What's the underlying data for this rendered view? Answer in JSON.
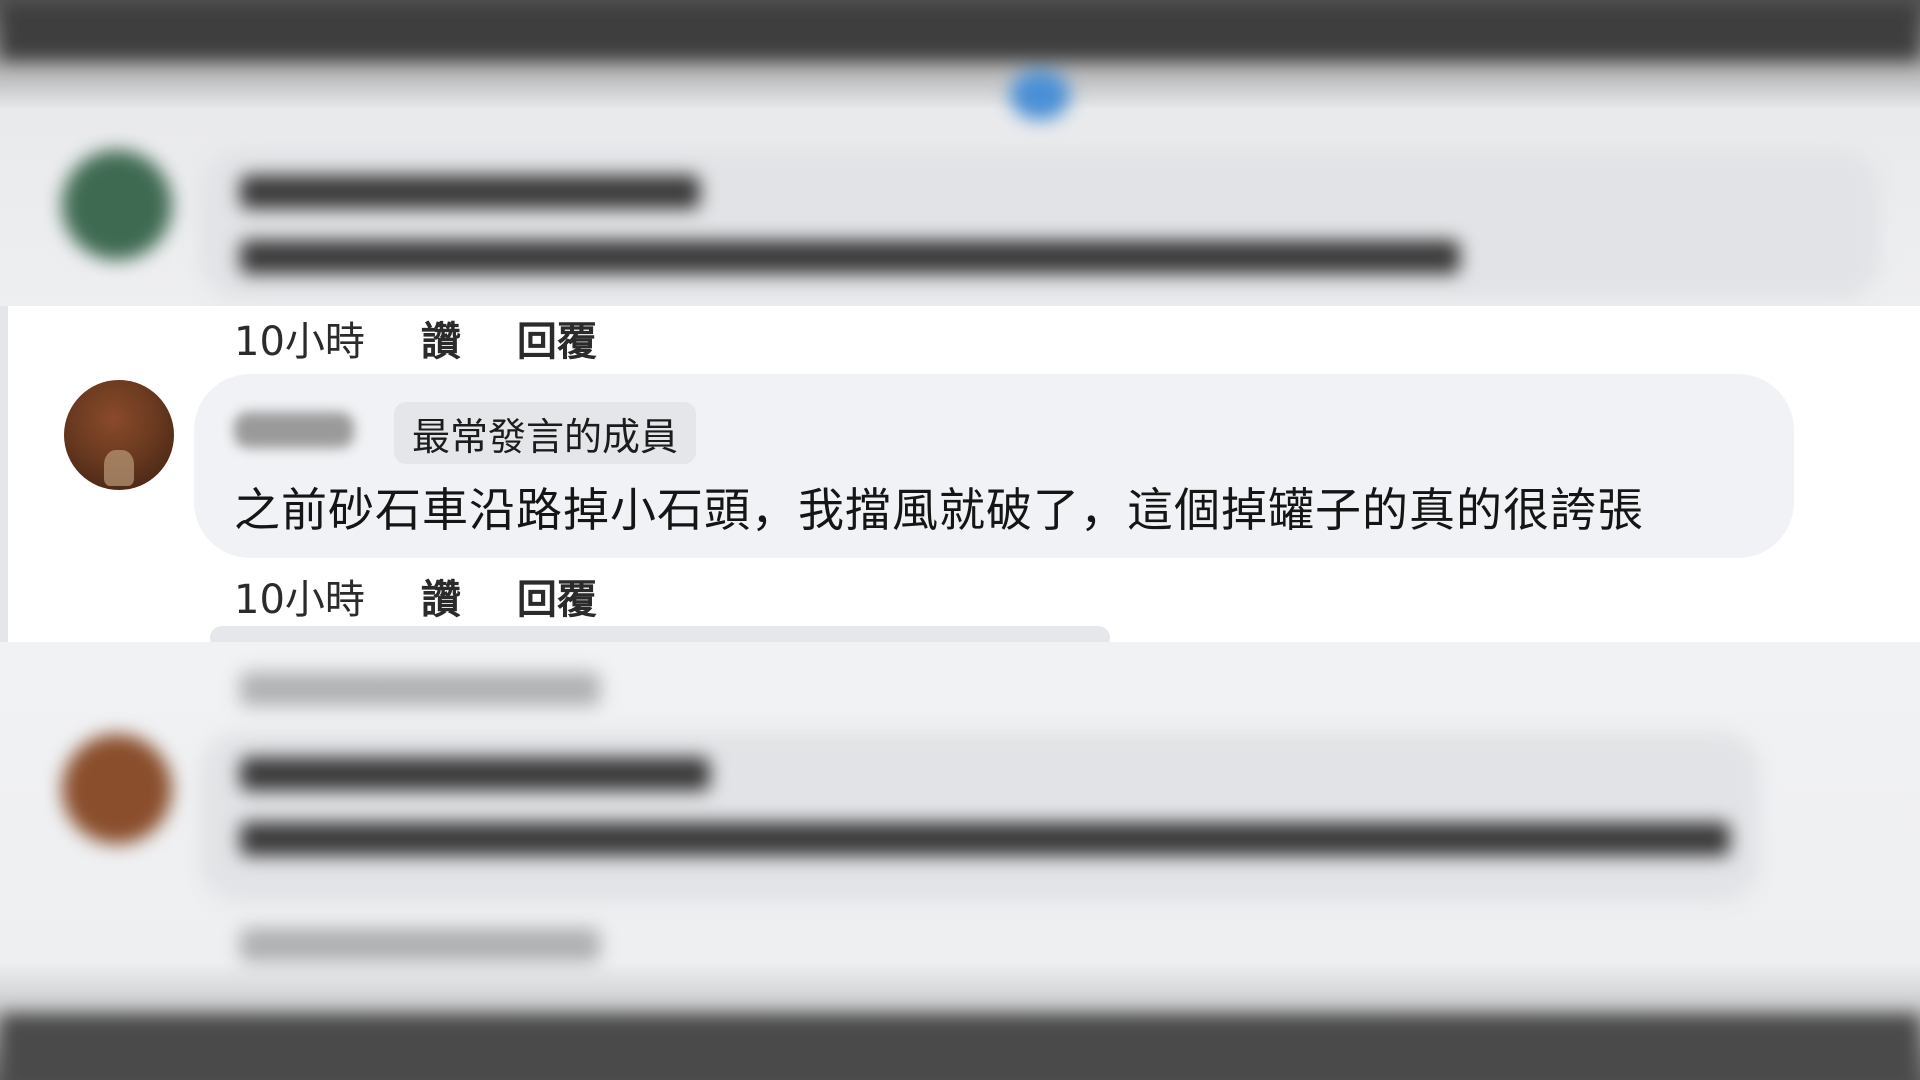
{
  "comment": {
    "badge": "最常發言的成員",
    "text": "之前砂石車沿路掉小石頭，我擋風就破了，這個掉罐子的真的很誇張",
    "time": "10小時",
    "like_label": "讚",
    "reply_label": "回覆"
  },
  "previous_comment": {
    "time": "10小時",
    "like_label": "讚",
    "reply_label": "回覆"
  },
  "colors": {
    "bubble": "#f0f2f5",
    "badge": "#e4e6e9",
    "text": "#151515"
  }
}
